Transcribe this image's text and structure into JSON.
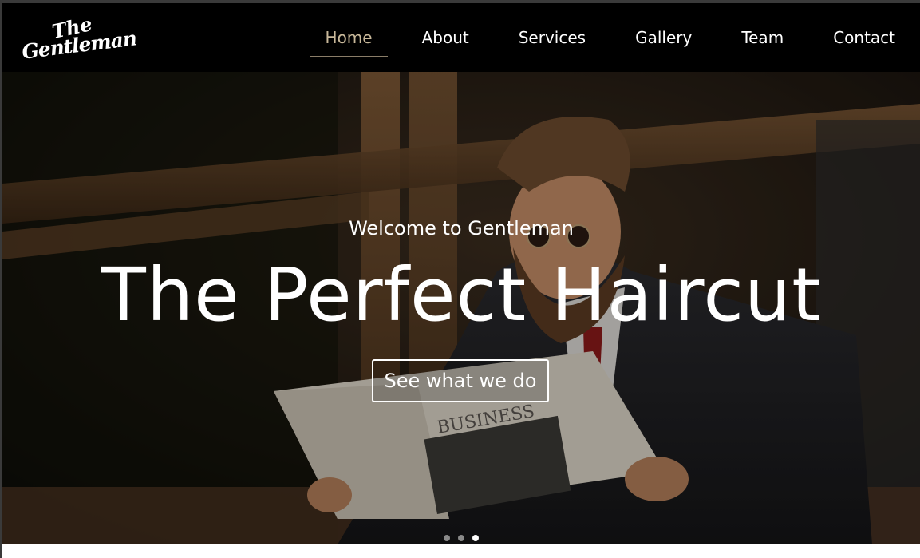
{
  "brand": {
    "logo_line1": "The",
    "logo_line2": "Gentleman"
  },
  "nav": {
    "items": [
      {
        "label": "Home",
        "active": true
      },
      {
        "label": "About",
        "active": false
      },
      {
        "label": "Services",
        "active": false
      },
      {
        "label": "Gallery",
        "active": false
      },
      {
        "label": "Team",
        "active": false
      },
      {
        "label": "Contact",
        "active": false
      }
    ]
  },
  "hero": {
    "subtitle": "Welcome to Gentleman",
    "title": "The Perfect Haircut",
    "cta_label": "See what we do",
    "background": "man-reading-newspaper-photo",
    "newspaper_headline": "BUSINESS"
  },
  "carousel": {
    "slide_count": 3,
    "active_index": 2
  },
  "colors": {
    "navbar_bg": "#000000",
    "active_nav": "#c8b89a",
    "text": "#ffffff"
  }
}
